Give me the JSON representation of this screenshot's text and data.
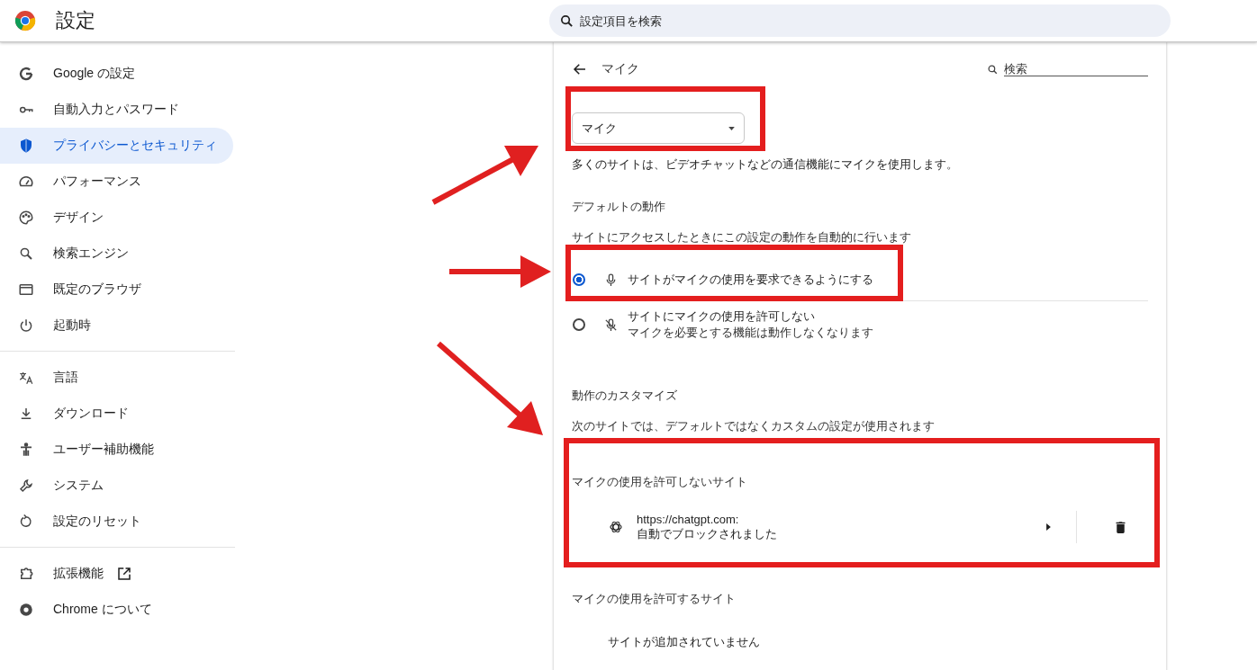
{
  "header": {
    "title": "設定",
    "search": {
      "placeholder": "設定項目を検索"
    }
  },
  "sidebar": {
    "groups": [
      [
        {
          "label": "Google の設定",
          "selected": false
        },
        {
          "label": "自動入力とパスワード",
          "selected": false
        },
        {
          "label": "プライバシーとセキュリティ",
          "selected": true
        },
        {
          "label": "パフォーマンス",
          "selected": false
        },
        {
          "label": "デザイン",
          "selected": false
        },
        {
          "label": "検索エンジン",
          "selected": false
        },
        {
          "label": "既定のブラウザ",
          "selected": false
        },
        {
          "label": "起動時",
          "selected": false
        }
      ],
      [
        {
          "label": "言語",
          "selected": false
        },
        {
          "label": "ダウンロード",
          "selected": false
        },
        {
          "label": "ユーザー補助機能",
          "selected": false
        },
        {
          "label": "システム",
          "selected": false
        },
        {
          "label": "設定のリセット",
          "selected": false
        }
      ],
      [
        {
          "label": "拡張機能",
          "selected": false,
          "external_link": true
        },
        {
          "label": "Chrome について",
          "selected": false
        }
      ]
    ]
  },
  "panel": {
    "title": "マイク",
    "search": {
      "placeholder": "検索"
    },
    "device": {
      "value": "マイク"
    },
    "description": "多くのサイトは、ビデオチャットなどの通信機能にマイクを使用します。",
    "default_behavior": {
      "heading": "デフォルトの動作",
      "subtitle": "サイトにアクセスしたときにこの設定の動作を自動的に行います",
      "options": [
        {
          "label": "サイトがマイクの使用を要求できるようにする",
          "selected": true
        },
        {
          "label": "サイトにマイクの使用を許可しない",
          "sublabel": "マイクを必要とする機能は動作しなくなります",
          "selected": false
        }
      ]
    },
    "custom": {
      "heading": "動作のカスタマイズ",
      "subtitle": "次のサイトでは、デフォルトではなくカスタムの設定が使用されます",
      "blocked": {
        "heading": "マイクの使用を許可しないサイト",
        "sites": [
          {
            "url": "https://chatgpt.com:",
            "status": "自動でブロックされました"
          }
        ]
      },
      "allowed": {
        "heading": "マイクの使用を許可するサイト",
        "empty": "サイトが追加されていません"
      }
    }
  }
}
